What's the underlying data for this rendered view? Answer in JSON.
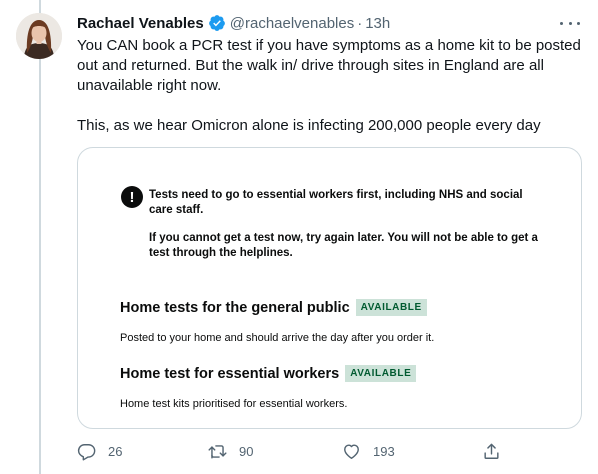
{
  "tweet": {
    "author_name": "Rachael Venables",
    "handle": "@rachaelvenables",
    "separator": "·",
    "time": "13h",
    "text": "You CAN book a PCR test if you have symptoms as a home kit to be posted out and returned. But the walk in/ drive through sites in England are all unavailable right now.\n\nThis, as we hear Omicron alone is infecting 200,000 people every day"
  },
  "card": {
    "alert_line1": "Tests need to go to essential workers first, including NHS and social care staff.",
    "alert_line2": "If you cannot get a test now, try again later. You will not be able to get a test through the helplines.",
    "options": [
      {
        "title": "Home tests for the general public",
        "badge": "AVAILABLE",
        "description": "Posted to your home and should arrive the day after you order it."
      },
      {
        "title": "Home test for essential workers",
        "badge": "AVAILABLE",
        "description": "Home test kits prioritised for essential workers."
      }
    ]
  },
  "actions": {
    "replies": "26",
    "retweets": "90",
    "likes": "193"
  },
  "colors": {
    "verified": "#1d9bf0",
    "badge_bg": "#cce2d8",
    "badge_text": "#005a30",
    "secondary_text": "#536471"
  }
}
